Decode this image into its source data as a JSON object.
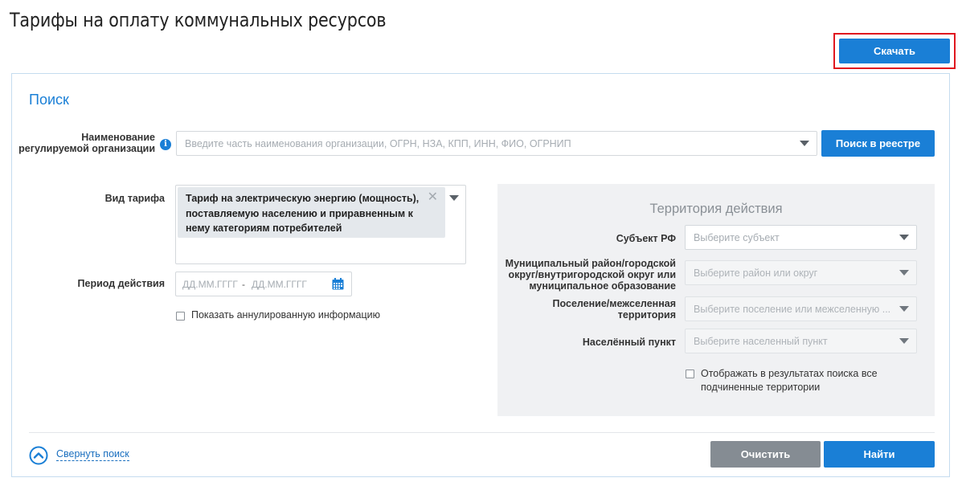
{
  "page": {
    "title": "Тарифы на оплату коммунальных ресурсов"
  },
  "toolbar": {
    "download_label": "Скачать"
  },
  "search": {
    "title": "Поиск",
    "org": {
      "label_line1": "Наименование",
      "label_line2": "регулируемой организации",
      "placeholder": "Введите часть наименования организации, ОГРН, НЗА, КПП, ИНН, ФИО, ОГРНИП",
      "search_registry_label": "Поиск в реестре"
    },
    "tariff": {
      "label": "Вид тарифа",
      "selected_line1": "Тариф на электрическую энергию (мощность),",
      "selected_line2": "поставляемую населению и приравненным к",
      "selected_line3": "нему категориям потребителей"
    },
    "period": {
      "label": "Период действия",
      "from_placeholder": "ДД.ММ.ГГГГ",
      "separator": "-",
      "to_placeholder": "ДД.ММ.ГГГГ"
    },
    "show_annulled_label": "Показать аннулированную информацию",
    "territory": {
      "title": "Территория действия",
      "subject": {
        "label": "Субъект РФ",
        "placeholder": "Выберите субъект"
      },
      "district": {
        "label_line1": "Муниципальный район/городской",
        "label_line2": "округ/внутригородской округ или",
        "label_line3": "муниципальное образование",
        "placeholder": "Выберите район или округ"
      },
      "settlement": {
        "label_line1": "Поселение/межселенная",
        "label_line2": "территория",
        "placeholder": "Выберите поселение или межселенную ..."
      },
      "locality": {
        "label": "Населённый пункт",
        "placeholder": "Выберите населенный пункт"
      },
      "show_subordinate_line1": "Отображать в результатах поиска все",
      "show_subordinate_line2": "подчиненные территории"
    },
    "collapse_label": "Свернуть поиск",
    "clear_label": "Очистить",
    "find_label": "Найти"
  },
  "colors": {
    "accent": "#1a7fd6",
    "highlight_border": "#e0171f",
    "secondary_button": "#858c93"
  }
}
